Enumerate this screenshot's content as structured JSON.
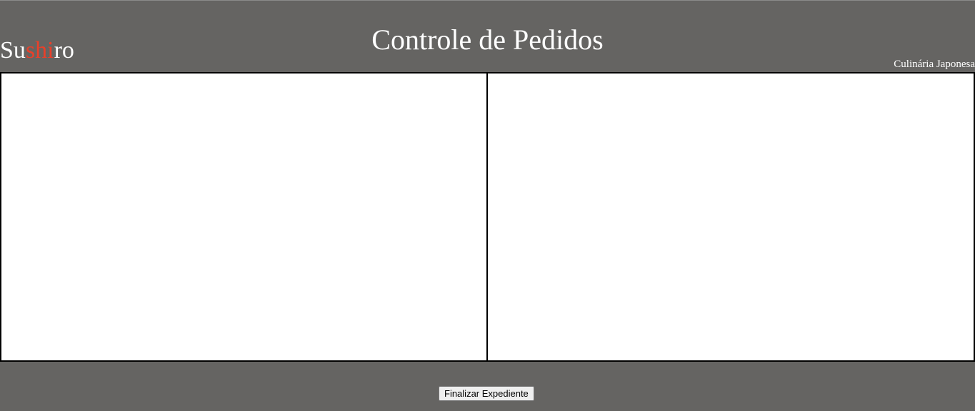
{
  "header": {
    "logo": {
      "part1": "Su",
      "part2": "shi",
      "part3": "ro"
    },
    "title": "Controle de Pedidos",
    "subtitle": "Culinária Japonesa"
  },
  "panels": {
    "left": {},
    "right": {}
  },
  "footer": {
    "finish_button_label": "Finalizar Expediente"
  },
  "colors": {
    "background": "#656462",
    "logo_accent": "#e8402a",
    "panel_background": "#ffffff",
    "panel_border": "#000000"
  }
}
